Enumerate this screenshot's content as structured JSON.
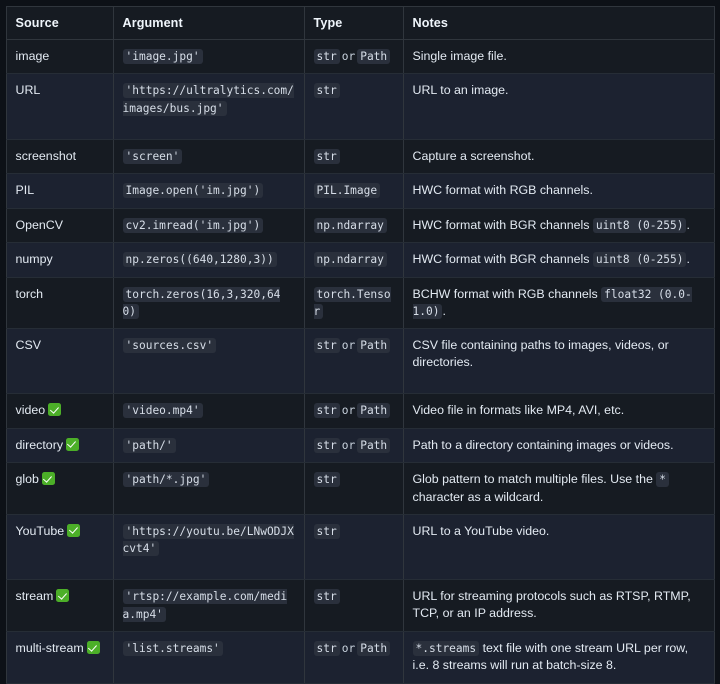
{
  "table": {
    "headers": [
      "Source",
      "Argument",
      "Type",
      "Notes"
    ],
    "rows": [
      {
        "source": "image",
        "check": false,
        "argument": "'image.jpg'",
        "type_a": "str",
        "type_sep": "or",
        "type_b": "Path",
        "notes_pre": "Single image file.",
        "notes_code": "",
        "notes_post": ""
      },
      {
        "source": "URL",
        "check": false,
        "argument": "'https://ultralytics.com/images/bus.jpg'",
        "type_a": "str",
        "type_sep": "",
        "type_b": "",
        "notes_pre": "URL to an image.",
        "notes_code": "",
        "notes_post": ""
      },
      {
        "source": "screenshot",
        "check": false,
        "argument": "'screen'",
        "type_a": "str",
        "type_sep": "",
        "type_b": "",
        "notes_pre": "Capture a screenshot.",
        "notes_code": "",
        "notes_post": ""
      },
      {
        "source": "PIL",
        "check": false,
        "argument": "Image.open('im.jpg')",
        "type_a": "PIL.Image",
        "type_sep": "",
        "type_b": "",
        "notes_pre": "HWC format with RGB channels.",
        "notes_code": "",
        "notes_post": ""
      },
      {
        "source": "OpenCV",
        "check": false,
        "argument": "cv2.imread('im.jpg')",
        "type_a": "np.ndarray",
        "type_sep": "",
        "type_b": "",
        "notes_pre": "HWC format with BGR channels ",
        "notes_code": "uint8 (0-255)",
        "notes_post": "."
      },
      {
        "source": "numpy",
        "check": false,
        "argument": "np.zeros((640,1280,3))",
        "type_a": "np.ndarray",
        "type_sep": "",
        "type_b": "",
        "notes_pre": "HWC format with BGR channels ",
        "notes_code": "uint8 (0-255)",
        "notes_post": "."
      },
      {
        "source": "torch",
        "check": false,
        "argument": "torch.zeros(16,3,320,640)",
        "type_a": "torch.Tensor",
        "type_sep": "",
        "type_b": "",
        "notes_pre": "BCHW format with RGB channels ",
        "notes_code": "float32 (0.0-1.0)",
        "notes_post": "."
      },
      {
        "source": "CSV",
        "check": false,
        "argument": "'sources.csv'",
        "type_a": "str",
        "type_sep": "or",
        "type_b": "Path",
        "notes_pre": "CSV file containing paths to images, videos, or directories.",
        "notes_code": "",
        "notes_post": ""
      },
      {
        "source": "video",
        "check": true,
        "argument": "'video.mp4'",
        "type_a": "str",
        "type_sep": "or",
        "type_b": "Path",
        "notes_pre": "Video file in formats like MP4, AVI, etc.",
        "notes_code": "",
        "notes_post": ""
      },
      {
        "source": "directory",
        "check": true,
        "argument": "'path/'",
        "type_a": "str",
        "type_sep": "or",
        "type_b": "Path",
        "notes_pre": "Path to a directory containing images or videos.",
        "notes_code": "",
        "notes_post": ""
      },
      {
        "source": "glob",
        "check": true,
        "argument": "'path/*.jpg'",
        "type_a": "str",
        "type_sep": "",
        "type_b": "",
        "notes_pre": "Glob pattern to match multiple files. Use the ",
        "notes_code": "*",
        "notes_post": " character as a wildcard."
      },
      {
        "source": "YouTube",
        "check": true,
        "argument": "'https://youtu.be/LNwODJXcvt4'",
        "type_a": "str",
        "type_sep": "",
        "type_b": "",
        "notes_pre": "URL to a YouTube video.",
        "notes_code": "",
        "notes_post": ""
      },
      {
        "source": "stream",
        "check": true,
        "argument": "'rtsp://example.com/media.mp4'",
        "type_a": "str",
        "type_sep": "",
        "type_b": "",
        "notes_pre": "URL for streaming protocols such as RTSP, RTMP, TCP, or an IP address.",
        "notes_code": "",
        "notes_post": ""
      },
      {
        "source": "multi-stream",
        "check": true,
        "argument": "'list.streams'",
        "type_a": "str",
        "type_sep": "or",
        "type_b": "Path",
        "notes_pre": "",
        "notes_code": "*.streams",
        "notes_post": " text file with one stream URL per row, i.e. 8 streams will run at batch-size 8."
      }
    ]
  },
  "colors": {
    "page_bg": "#0d1117",
    "row_odd": "#161b22",
    "row_even": "#1c2230",
    "border": "#30363d",
    "text": "#e3eaf2",
    "code_bg": "#2a303c",
    "check_green": "#4caf28"
  }
}
